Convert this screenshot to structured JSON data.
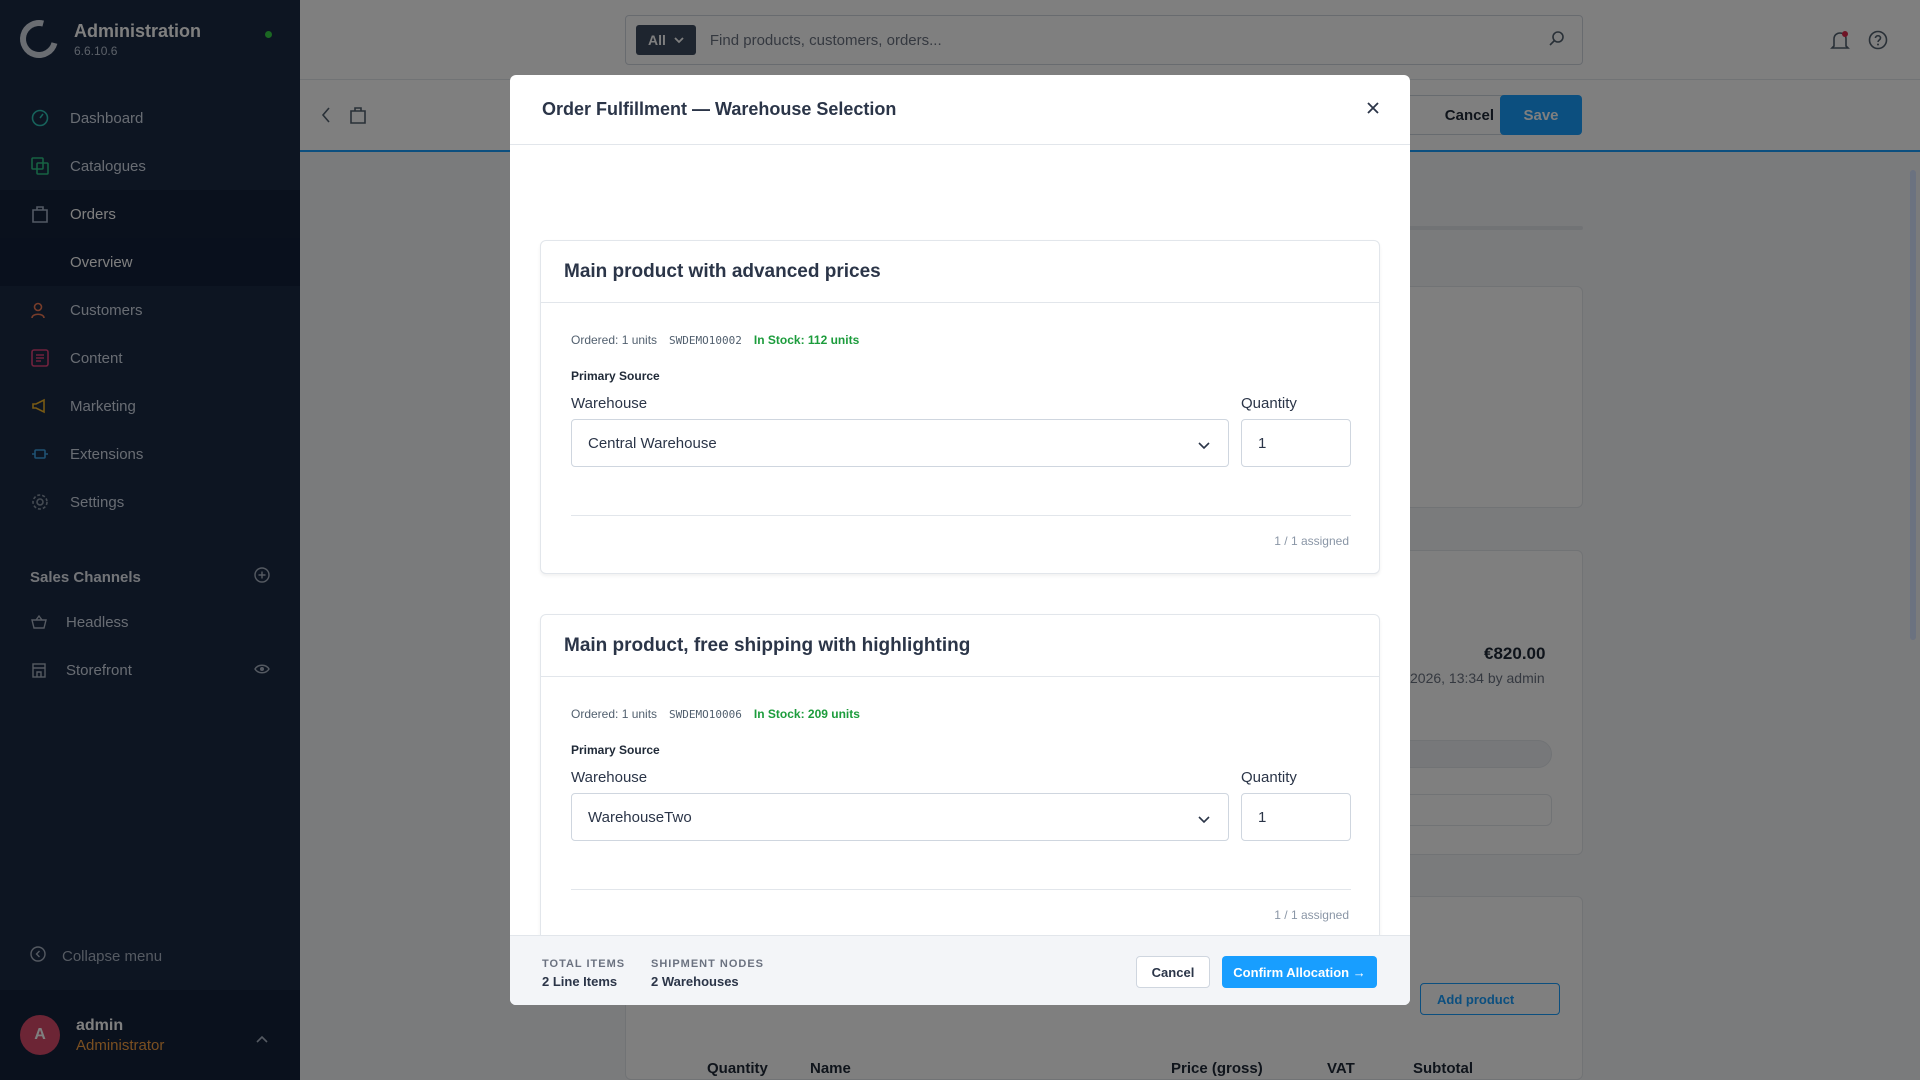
{
  "app": {
    "title": "Administration",
    "version": "6.6.10.6"
  },
  "sidebar": {
    "items": [
      {
        "label": "Dashboard",
        "icon": "dashboard-icon",
        "color": "#2ec4b6"
      },
      {
        "label": "Catalogues",
        "icon": "catalogue-icon",
        "color": "#2ec486"
      },
      {
        "label": "Orders",
        "icon": "orders-icon",
        "color": "#a6b3c6"
      },
      {
        "label": "Customers",
        "icon": "customers-icon",
        "color": "#f07a54"
      },
      {
        "label": "Content",
        "icon": "content-icon",
        "color": "#e0447a"
      },
      {
        "label": "Marketing",
        "icon": "marketing-icon",
        "color": "#f0b429"
      },
      {
        "label": "Extensions",
        "icon": "extensions-icon",
        "color": "#3ea3e6"
      },
      {
        "label": "Settings",
        "icon": "settings-icon",
        "color": "#8a96a6"
      }
    ],
    "active_sub": "Overview",
    "sales_channels_label": "Sales Channels",
    "sales_channels": [
      {
        "label": "Headless",
        "icon": "basket-icon"
      },
      {
        "label": "Storefront",
        "icon": "storefront-icon"
      }
    ],
    "collapse_label": "Collapse menu",
    "user": {
      "initial": "A",
      "name": "admin",
      "role": "Administrator"
    }
  },
  "topbar": {
    "search_type": "All",
    "search_placeholder": "Find products, customers, orders..."
  },
  "page_header": {
    "cancel": "Cancel",
    "save": "Save"
  },
  "background": {
    "amount": "€820.00",
    "meta": "2026, 13:34 by admin",
    "add_product": "Add product",
    "table_headers": [
      "Quantity",
      "Name",
      "Price (gross)",
      "VAT",
      "Subtotal"
    ]
  },
  "modal": {
    "title": "Order Fulfillment — Warehouse Selection",
    "products": [
      {
        "name": "Main product with advanced prices",
        "ordered": "Ordered: 1 units",
        "sku": "SWDEMO10002",
        "stock": "In Stock: 112 units",
        "primary_source": "Primary Source",
        "warehouse_label": "Warehouse",
        "warehouse_value": "Central Warehouse",
        "quantity_label": "Quantity",
        "quantity_value": "1",
        "assigned": "1 / 1 assigned"
      },
      {
        "name": "Main product, free shipping with highlighting",
        "ordered": "Ordered: 1 units",
        "sku": "SWDEMO10006",
        "stock": "In Stock: 209 units",
        "primary_source": "Primary Source",
        "warehouse_label": "Warehouse",
        "warehouse_value": "WarehouseTwo",
        "quantity_label": "Quantity",
        "quantity_value": "1",
        "assigned": "1 / 1 assigned"
      }
    ],
    "footer": {
      "total_items_label": "TOTAL ITEMS",
      "total_items_value": "2 Line Items",
      "shipment_nodes_label": "SHIPMENT NODES",
      "shipment_nodes_value": "2 Warehouses",
      "cancel": "Cancel",
      "confirm": "Confirm Allocation →"
    }
  },
  "colors": {
    "accent": "#189eff",
    "stock": "#1c9c3c",
    "sidebar": "#1a2a44"
  }
}
